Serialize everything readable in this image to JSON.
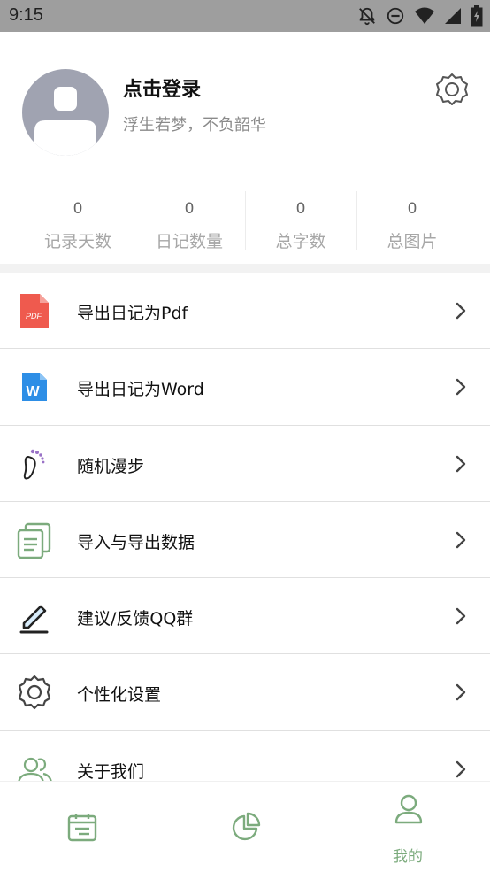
{
  "status_bar": {
    "time": "9:15",
    "icons": [
      "notifications-off-icon",
      "do-not-disturb-icon",
      "wifi-icon",
      "signal-icon",
      "battery-charging-icon"
    ]
  },
  "profile": {
    "title": "点击登录",
    "subtitle": "浮生若梦，不负韶华",
    "avatar_icon": "user-avatar-icon",
    "settings_icon": "gear-icon"
  },
  "stats": [
    {
      "value": "0",
      "label": "记录天数"
    },
    {
      "value": "0",
      "label": "日记数量"
    },
    {
      "value": "0",
      "label": "总字数"
    },
    {
      "value": "0",
      "label": "总图片"
    }
  ],
  "menu": [
    {
      "label": "导出日记为Pdf",
      "icon": "pdf-file-icon"
    },
    {
      "label": "导出日记为Word",
      "icon": "word-file-icon"
    },
    {
      "label": "随机漫步",
      "icon": "footprint-icon"
    },
    {
      "label": "导入与导出数据",
      "icon": "documents-icon"
    },
    {
      "label": "建议/反馈QQ群",
      "icon": "edit-pen-icon"
    },
    {
      "label": "个性化设置",
      "icon": "gear-icon"
    },
    {
      "label": "关于我们",
      "icon": "users-icon"
    }
  ],
  "pdf_badge": "PDF",
  "word_badge": "W",
  "bottom_nav": {
    "items": [
      {
        "icon": "calendar-icon",
        "active": false
      },
      {
        "icon": "pie-chart-icon",
        "active": false
      },
      {
        "icon": "person-icon",
        "label": "我的",
        "active": true
      }
    ]
  },
  "colors": {
    "accent": "#7cab7d",
    "status_bar": "#9e9e9e",
    "avatar": "#a0a3b1",
    "pdf": "#ef5a4e",
    "word": "#2d8ee6"
  }
}
